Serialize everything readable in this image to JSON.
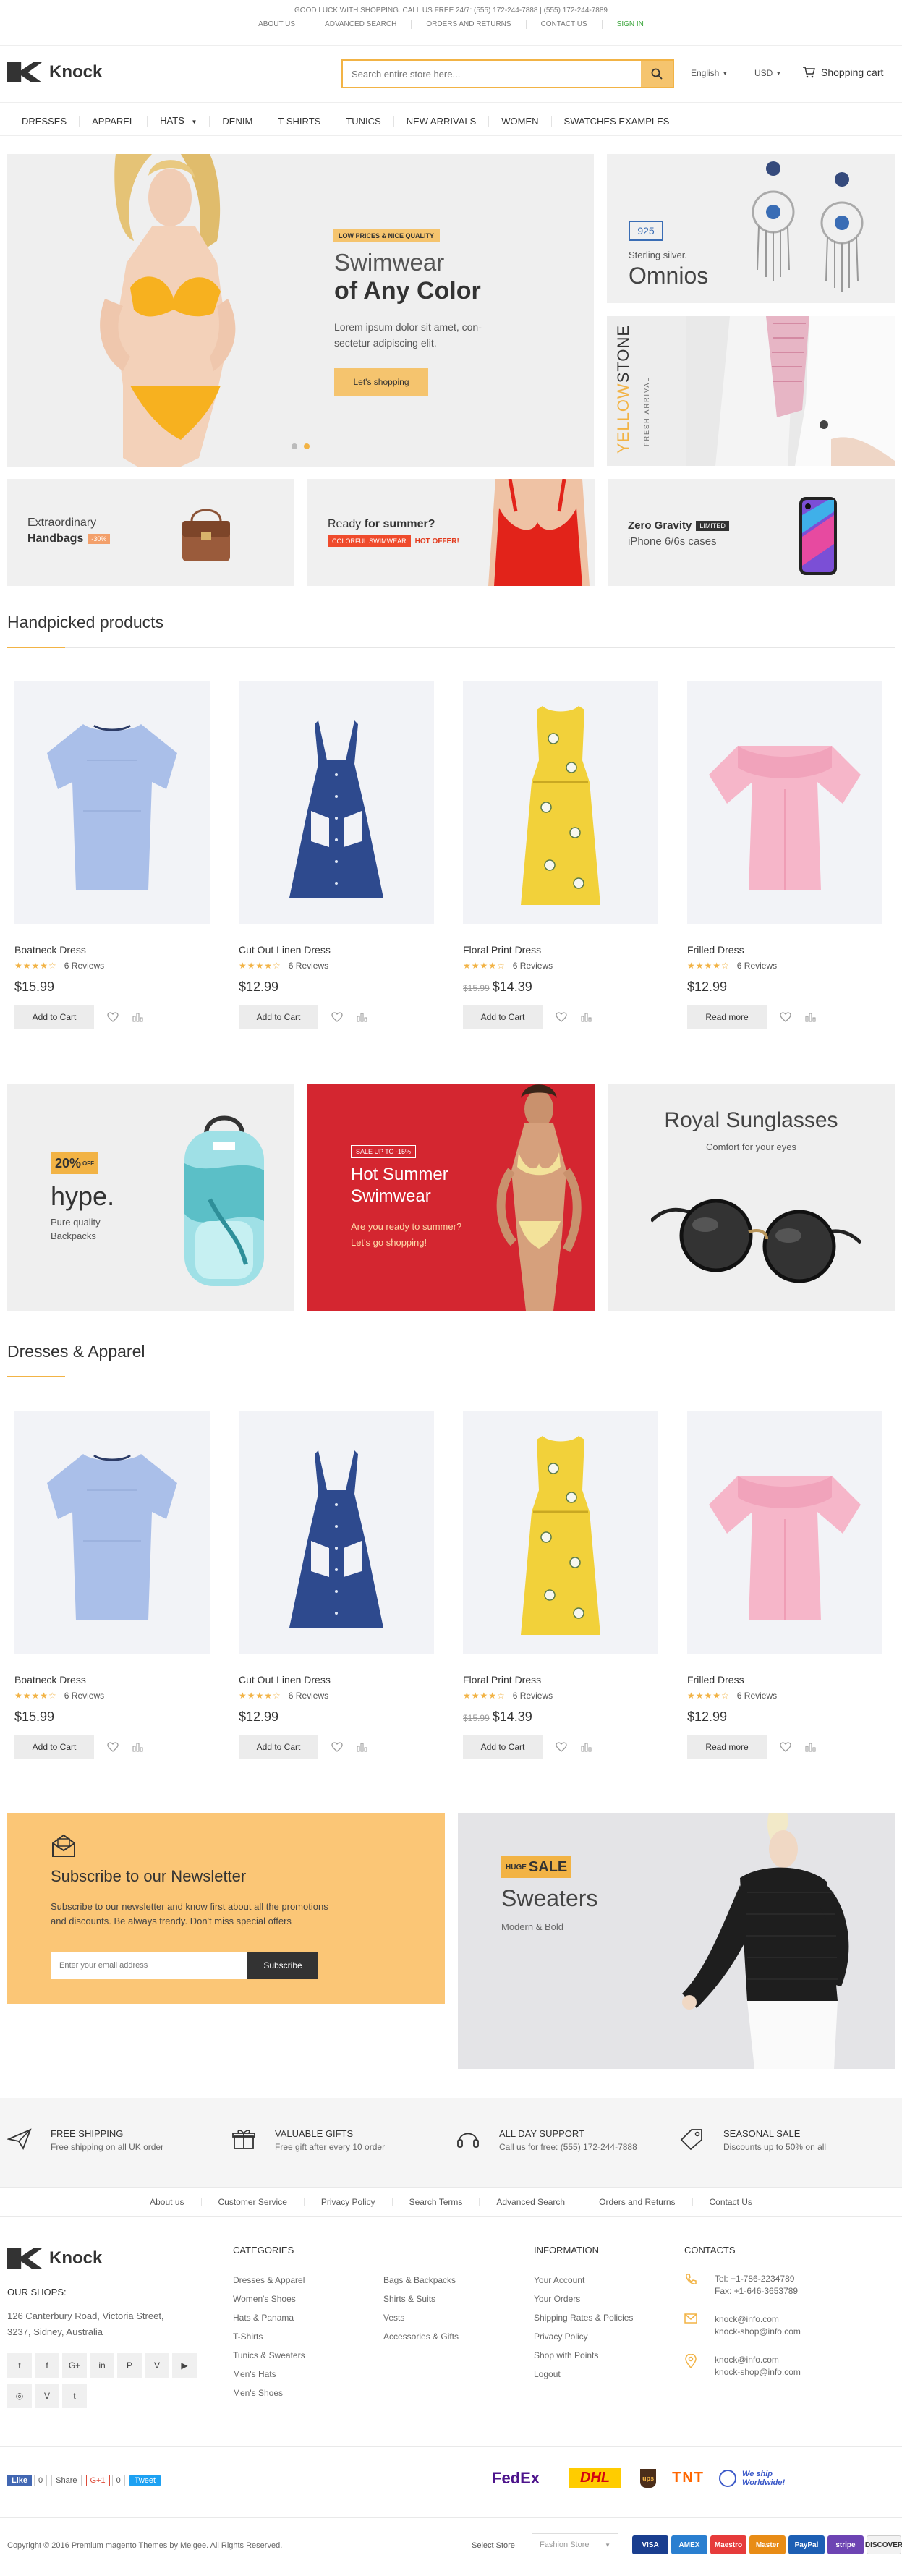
{
  "topbar": {
    "promo": "GOOD LUCK WITH SHOPPING. CALL US FREE 24/7: (555) 172-244-7888 | (555) 172-244-7889",
    "links": [
      "ABOUT US",
      "ADVANCED SEARCH",
      "ORDERS AND RETURNS",
      "CONTACT US",
      "SIGN IN"
    ]
  },
  "header": {
    "logo": "Knock",
    "search_placeholder": "Search entire store here...",
    "language": "English",
    "currency": "USD",
    "cart": "Shopping cart"
  },
  "nav": [
    "DRESSES",
    "APPAREL",
    "HATS",
    "DENIM",
    "T-SHIRTS",
    "TUNICS",
    "NEW ARRIVALS",
    "WOMEN",
    "SWATCHES EXAMPLES"
  ],
  "hero": {
    "badge": "LOW PRICES & NICE QUALITY",
    "title1": "Swimwear",
    "title2": "of Any Color",
    "text": "Lorem ipsum dolor sit amet, con-sectetur adipiscing elit.",
    "button": "Let's shopping"
  },
  "omnios": {
    "badge": "925",
    "sub": "Sterling silver.",
    "title": "Omnios"
  },
  "yellowstone": {
    "title_a": "YELLOW",
    "title_b": "STONE",
    "sub": "FRESH ARRIVAL"
  },
  "promos": {
    "handbags_a": "Extraordinary",
    "handbags_b": "Handbags",
    "handbags_tag": "-30%",
    "summer_a": "Ready ",
    "summer_b": "for summer?",
    "summer_tag": "COLORFUL SWIMWEAR",
    "summer_hot": "HOT OFFER!",
    "gravity_a": "Zero Gravity",
    "gravity_tag": "LIMITED",
    "gravity_b": "iPhone 6/6s cases"
  },
  "sections": {
    "handpicked": "Handpicked products",
    "dresses": "Dresses & Apparel"
  },
  "products": [
    {
      "name": "Boatneck Dress",
      "reviews": "6 Reviews",
      "old_price": "",
      "price": "$15.99",
      "button": "Add to Cart",
      "rating": 4
    },
    {
      "name": "Cut Out Linen Dress",
      "reviews": "6 Reviews",
      "old_price": "",
      "price": "$12.99",
      "button": "Add to Cart",
      "rating": 4
    },
    {
      "name": "Floral Print Dress",
      "reviews": "6 Reviews",
      "old_price": "$15.99",
      "price": "$14.39",
      "button": "Add to Cart",
      "rating": 4
    },
    {
      "name": "Frilled Dress",
      "reviews": "6 Reviews",
      "old_price": "",
      "price": "$12.99",
      "button": "Read more",
      "rating": 4
    }
  ],
  "banners": {
    "hype_off": "20%",
    "hype_off2": "OFF",
    "hype_title": "hype.",
    "hype_sub1": "Pure quality",
    "hype_sub2": "Backpacks",
    "sale_tag": "SALE UP TO -15%",
    "sale_title1": "Hot Summer",
    "sale_title2": "Swimwear",
    "sale_text1": "Are you ready to summer?",
    "sale_text2": "Let's go shopping!",
    "sun_title": "Royal Sunglasses",
    "sun_sub": "Comfort for your eyes"
  },
  "newsletter": {
    "title": "Subscribe to our Newsletter",
    "text1": "Subscribe to our newsletter and know first about all the promotions",
    "text2": "and discounts. Be always trendy. Don't miss special offers",
    "placeholder": "Enter your email address",
    "button": "Subscribe"
  },
  "sweaters": {
    "huge": "HUGE",
    "sale": "SALE",
    "title": "Sweaters",
    "sub": "Modern & Bold"
  },
  "features": [
    {
      "title": "FREE SHIPPING",
      "sub": "Free shipping on all UK order"
    },
    {
      "title": "VALUABLE GIFTS",
      "sub": "Free gift after every 10 order"
    },
    {
      "title": "ALL DAY SUPPORT",
      "sub": "Call us for free: (555) 172-244-7888"
    },
    {
      "title": "SEASONAL SALE",
      "sub": "Discounts up to 50% on all"
    }
  ],
  "footer_links": [
    "About us",
    "Customer Service",
    "Privacy Policy",
    "Search Terms",
    "Advanced Search",
    "Orders and Returns",
    "Contact Us"
  ],
  "footer": {
    "logo": "Knock",
    "shops_h": "OUR SHOPS:",
    "address1": "126 Canterbury Road, Victoria Street,",
    "address2": "3237, Sidney, Australia",
    "categories_h": "CATEGORIES",
    "cat_a": [
      "Dresses & Apparel",
      "Women's Shoes",
      "Hats & Panama",
      "T-Shirts",
      "Tunics & Sweaters",
      "Men's Hats",
      "Men's Shoes"
    ],
    "cat_b": [
      "Bags & Backpacks",
      "Shirts & Suits",
      "Vests",
      "Accessories & Gifts"
    ],
    "info_h": "INFORMATION",
    "info": [
      "Your Account",
      "Your Orders",
      "Shipping Rates & Policies",
      "Privacy Policy",
      "Shop with Points",
      "Logout"
    ],
    "contacts_h": "CONTACTS",
    "tel": "Tel: +1-786-2234789",
    "fax": "Fax: +1-646-3653789",
    "mail1": "knock@info.com",
    "mail2": "knock-shop@info.com",
    "skype1": "knock@info.com",
    "skype2": "knock-shop@info.com",
    "social": [
      "t",
      "f",
      "G+",
      "in",
      "P",
      "V",
      "▶",
      "◎",
      "V",
      "t"
    ]
  },
  "share": {
    "like": "Like",
    "like_count": "0",
    "share": "Share",
    "g": "G+1",
    "g_count": "0",
    "tweet": "Tweet"
  },
  "shipping": {
    "fedex": "FedEx",
    "dhl": "DHL",
    "ups": "ups",
    "tnt": "TNT",
    "ww_a": "We ship",
    "ww_b": "Worldwide!"
  },
  "bottom": {
    "copyright": "Copyright © 2016 Premium magento Themes by Meigee. All Rights Reserved.",
    "store_label": "Select Store",
    "store_value": "Fashion Store",
    "payments": [
      "VISA",
      "AMEX",
      "Maestro",
      "Master",
      "PayPal",
      "stripe",
      "DISCOVER"
    ]
  }
}
